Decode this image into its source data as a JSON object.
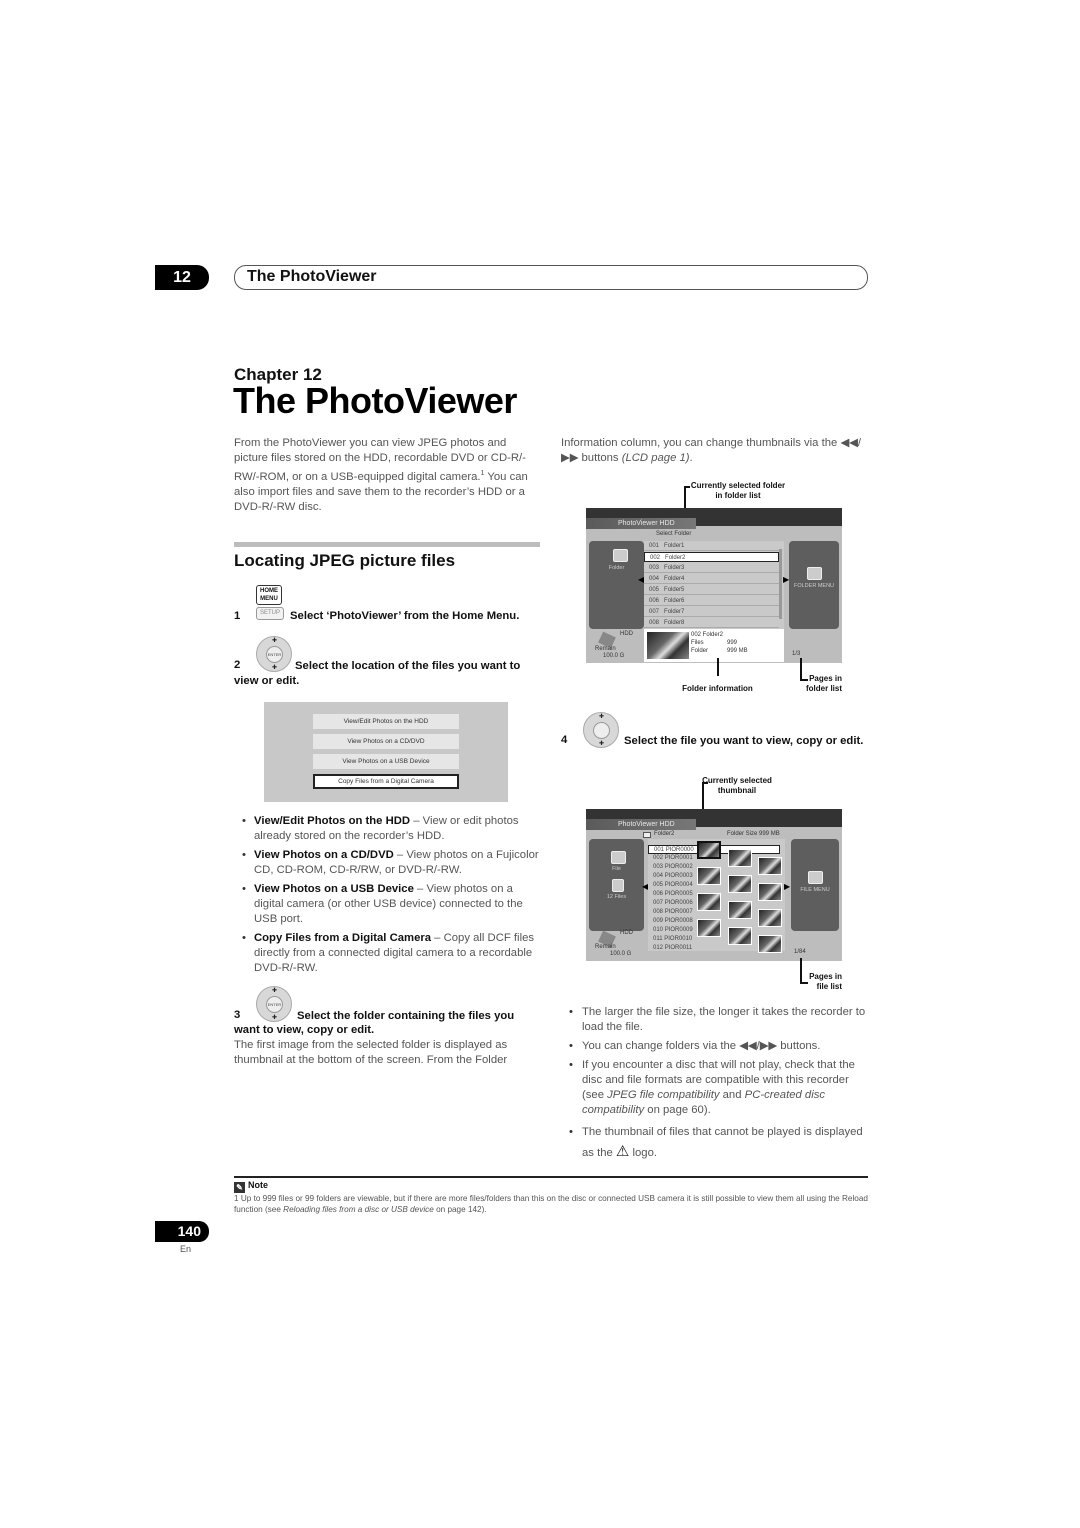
{
  "header": {
    "chapter_number": "12",
    "running_title": "The PhotoViewer"
  },
  "chapter": {
    "label": "Chapter 12",
    "title": "The PhotoViewer"
  },
  "intro": "From the PhotoViewer you can view JPEG photos and picture files stored on the HDD, recordable DVD or CD-R/-RW/-ROM, or on a USB-equipped digital camera.",
  "intro_footnote_ref": "1",
  "intro_cont": " You can also import files and save them to the recorder’s HDD or a DVD-R/-RW disc.",
  "section_title": "Locating JPEG picture files",
  "keys": {
    "home_menu": "HOME MENU",
    "setup": "SETUP",
    "enter": "ENTER"
  },
  "steps": [
    {
      "num": "1",
      "text": "Select ‘PhotoViewer’ from the Home Menu."
    },
    {
      "num": "2",
      "text": "Select the location of the files you want to view or edit."
    },
    {
      "num": "3",
      "text": "Select the folder containing the files you want to view, copy or edit."
    },
    {
      "num": "4",
      "text": "Select the file you want to view, copy or edit."
    }
  ],
  "home_menu_screen": {
    "options": [
      "View/Edit Photos on the HDD",
      "View Photos on a CD/DVD",
      "View Photos on a USB Device",
      "Copy Files from a Digital Camera"
    ],
    "selected_index": 3
  },
  "bullets_left": [
    {
      "term": "View/Edit Photos on the HDD",
      "desc": " – View or edit photos already stored on the recorder’s HDD."
    },
    {
      "term": "View Photos on a CD/DVD",
      "desc": " – View photos on a Fujicolor CD, CD-ROM, CD-R/RW, or DVD-R/-RW."
    },
    {
      "term": "View Photos on a USB Device",
      "desc": " – View photos on a digital camera (or other USB device) connected to the USB port."
    },
    {
      "term": "Copy Files from a Digital Camera",
      "desc": " – Copy all DCF files directly from a connected digital camera to a recordable DVD-R/-RW."
    }
  ],
  "step3_desc": "The first image from the selected folder is displayed as thumbnail at the bottom of the screen. From the Folder",
  "right_intro": {
    "text": "Information column, you can change thumbnails via the ◀◀/▶▶ buttons ",
    "ref": "(LCD page 1)",
    "end": "."
  },
  "folder_screen": {
    "title": "PhotoViewer  HDD",
    "list_header": "Select Folder",
    "folders": [
      {
        "num": "001",
        "name": "Folder1"
      },
      {
        "num": "002",
        "name": "Folder2"
      },
      {
        "num": "003",
        "name": "Folder3"
      },
      {
        "num": "004",
        "name": "Folder4"
      },
      {
        "num": "005",
        "name": "Folder5"
      },
      {
        "num": "006",
        "name": "Folder6"
      },
      {
        "num": "007",
        "name": "Folder7"
      },
      {
        "num": "008",
        "name": "Folder8"
      }
    ],
    "selected_index": 1,
    "left_label": "Folder",
    "right_label": "FOLDER MENU",
    "device": "HDD",
    "remain_label": "Remain",
    "remain_value": "100.0 G",
    "info_name": "002  Folder2",
    "info_files_label": "Files",
    "info_files_value": "999",
    "info_folder_label": "Folder",
    "info_folder_value": "999 MB",
    "pages": "1/3",
    "callouts": {
      "selected_folder": "Currently selected folder in folder list",
      "folder_info": "Folder information",
      "pages": "Pages in folder list"
    }
  },
  "file_screen": {
    "title": "PhotoViewer  HDD",
    "folder_name": "Folder2",
    "folder_size": "Folder Size 999 MB",
    "files": [
      {
        "num": "001",
        "name": "PIOR0000"
      },
      {
        "num": "002",
        "name": "PIOR0001"
      },
      {
        "num": "003",
        "name": "PIOR0002"
      },
      {
        "num": "004",
        "name": "PIOR0003"
      },
      {
        "num": "005",
        "name": "PIOR0004"
      },
      {
        "num": "006",
        "name": "PIOR0005"
      },
      {
        "num": "007",
        "name": "PIOR0006"
      },
      {
        "num": "008",
        "name": "PIOR0007"
      },
      {
        "num": "009",
        "name": "PIOR0008"
      },
      {
        "num": "010",
        "name": "PIOR0009"
      },
      {
        "num": "011",
        "name": "PIOR0010"
      },
      {
        "num": "012",
        "name": "PIOR0011"
      }
    ],
    "selected_index": 0,
    "left_label_file": "File",
    "left_label_count": "12 Files",
    "right_label": "FILE MENU",
    "device": "HDD",
    "remain_label": "Remain",
    "remain_value": "100.0 G",
    "pages": "1/84",
    "callouts": {
      "selected_thumb": "Currently selected thumbnail",
      "pages": "Pages in file list"
    }
  },
  "bullets_right": [
    {
      "text": "The larger the file size, the longer it takes the recorder to load the file."
    },
    {
      "text": "You can change folders via the ◀◀/▶▶ buttons."
    },
    {
      "text": "If you encounter a disc that will not play, check that the disc and file formats are compatible with this recorder (see ",
      "i1": "JPEG file compatibility",
      "mid": " and ",
      "i2": "PC-created disc compatibility",
      "end": " on page 60)."
    },
    {
      "text": "The thumbnail of files that cannot be played is displayed as the ",
      "end": " logo."
    }
  ],
  "note": {
    "label": "Note",
    "text": "1 Up to 999 files or 99 folders are viewable, but if there are more files/folders than this on the disc or connected USB camera it is still possible to view them all using the Reload function (see ",
    "ref": "Reloading files from a disc or USB device",
    "end": " on page 142)."
  },
  "footer": {
    "page_number": "140",
    "lang": "En"
  }
}
